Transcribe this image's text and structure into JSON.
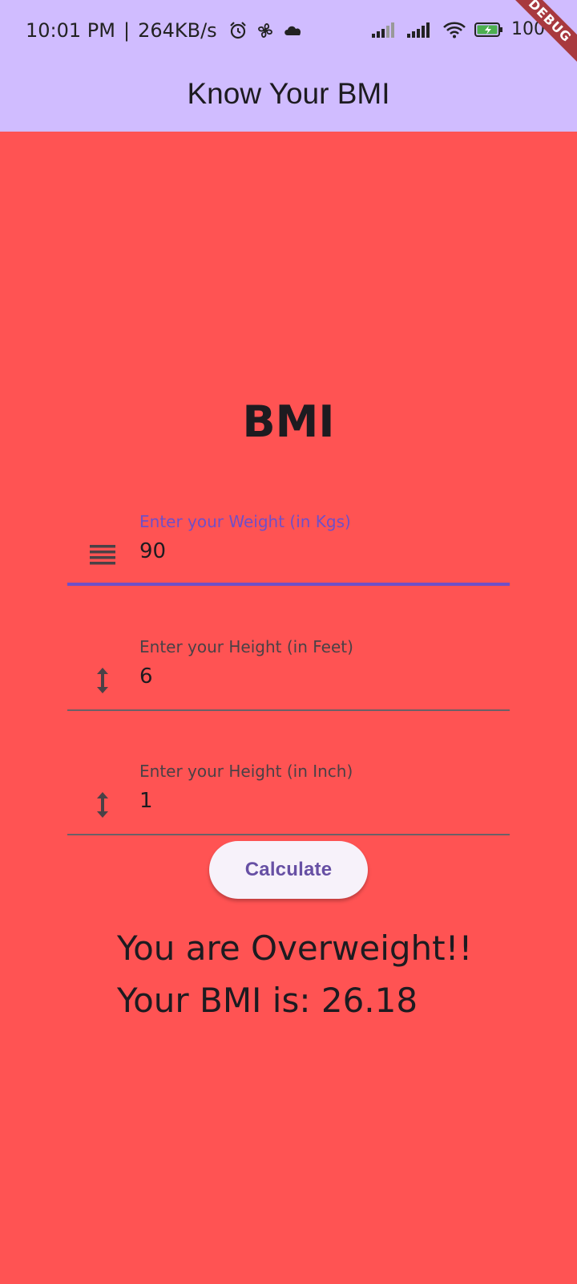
{
  "status_bar": {
    "time": "10:01 PM",
    "separator": "|",
    "network_speed": "264KB/s",
    "battery": "100"
  },
  "app_bar": {
    "title": "Know Your BMI"
  },
  "debug_banner": "DEBUG",
  "main": {
    "heading": "BMI",
    "fields": [
      {
        "label": "Enter your Weight (in Kgs)",
        "value": "90",
        "icon": "weight-lines-icon",
        "focused": true
      },
      {
        "label": "Enter your Height (in Feet)",
        "value": "6",
        "icon": "height-arrows-icon",
        "focused": false
      },
      {
        "label": "Enter your Height (in Inch)",
        "value": "1",
        "icon": "height-arrows-icon",
        "focused": false
      }
    ],
    "calculate_label": "Calculate",
    "result_message": "You are Overweight!!",
    "result_bmi": "Your BMI is: 26.18"
  },
  "colors": {
    "background": "#ff5353",
    "app_bar": "#d0bcff",
    "accent": "#6f4fc8",
    "button_text": "#6750a4"
  }
}
